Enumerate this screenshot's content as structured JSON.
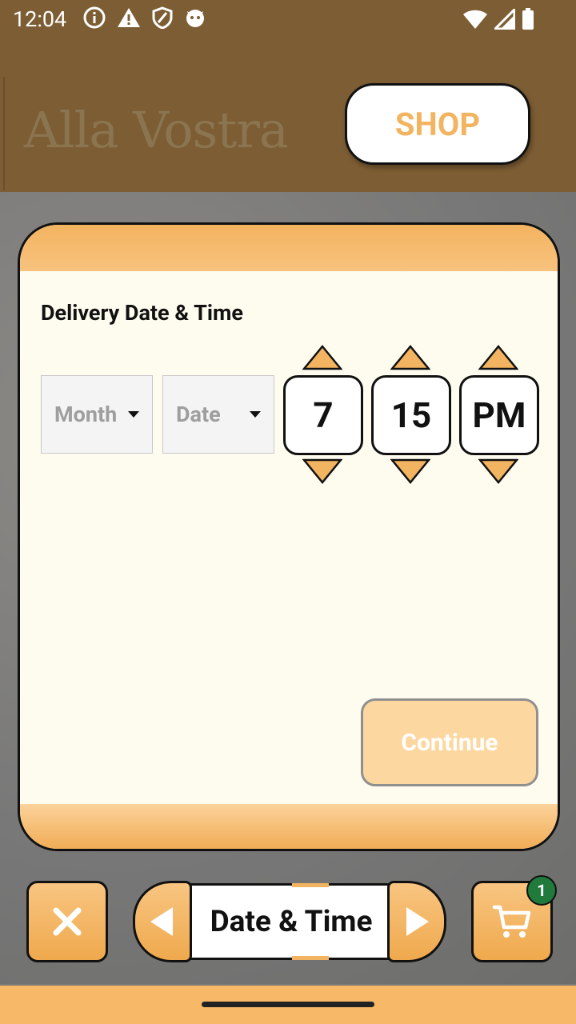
{
  "status_bar": {
    "time": "12:04"
  },
  "header": {
    "brand": "Alla Vostra",
    "shop_label": "SHOP"
  },
  "form": {
    "title": "Delivery Date & Time",
    "month_placeholder": "Month",
    "date_placeholder": "Date",
    "hour": "7",
    "minute": "15",
    "ampm": "PM",
    "continue_label": "Continue"
  },
  "bottom_nav": {
    "step_label": "Date & Time",
    "cart_count": "1"
  },
  "colors": {
    "brown": "#7d5d34",
    "orange": "#f2b461",
    "cream": "#fefbef",
    "badge_green": "#1f7a3c"
  }
}
